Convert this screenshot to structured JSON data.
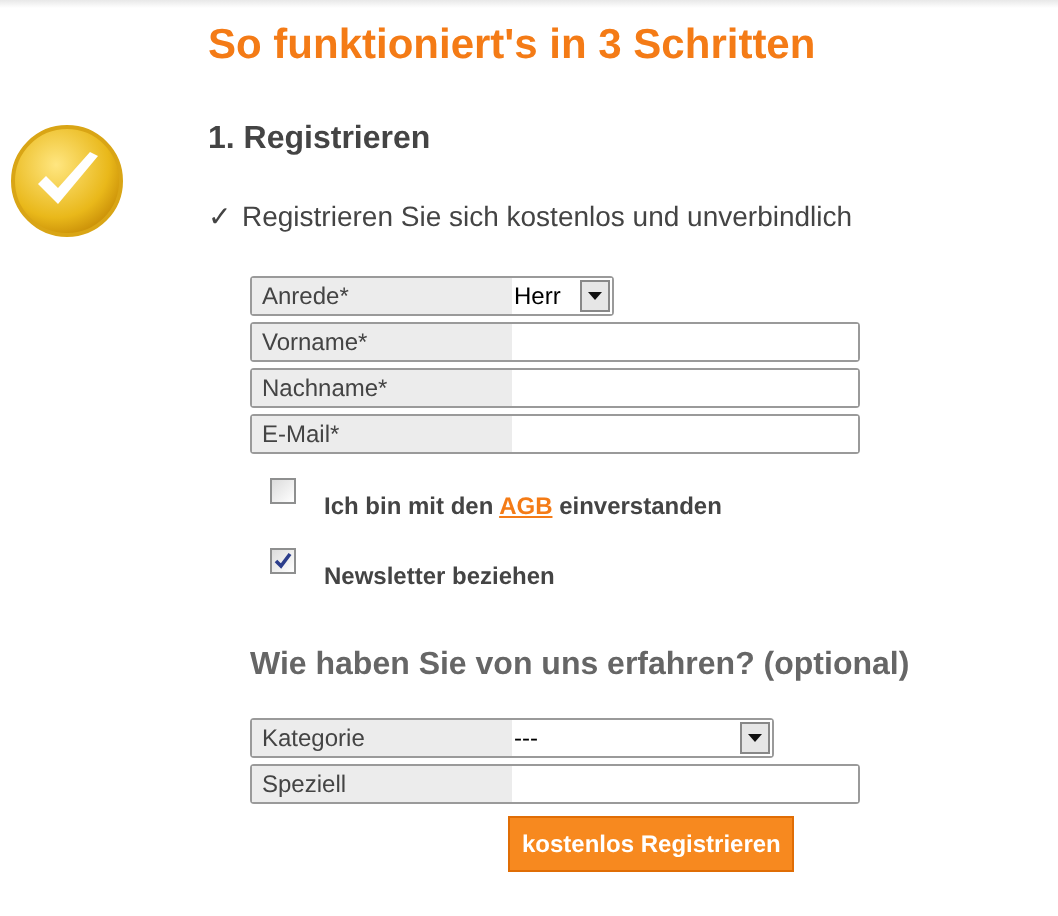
{
  "title": "So funktioniert's in 3 Schritten",
  "step": {
    "heading": "1. Registrieren",
    "check_mark": "✓",
    "intro": "Registrieren Sie sich kostenlos und unverbindlich"
  },
  "fields": [
    {
      "kind": "compact_select",
      "label": "Anrede*",
      "value": "Herr"
    },
    {
      "kind": "text",
      "label": "Vorname*"
    },
    {
      "kind": "text",
      "label": "Nachname*"
    },
    {
      "kind": "text",
      "label": "E-Mail*"
    }
  ],
  "checkboxes": [
    {
      "parts": [
        "Ich bin mit den ",
        "AGB",
        " einverstanden"
      ],
      "checked": false
    },
    {
      "parts": [
        "Newsletter beziehen"
      ],
      "checked": true
    }
  ],
  "optional_heading": "Wie haben Sie von uns erfahren? (optional)",
  "optional_fields": [
    {
      "kind": "select",
      "label": "Kategorie",
      "value": "---"
    },
    {
      "kind": "text",
      "label": "Speziell"
    }
  ],
  "submit": "kostenlos Registrieren"
}
